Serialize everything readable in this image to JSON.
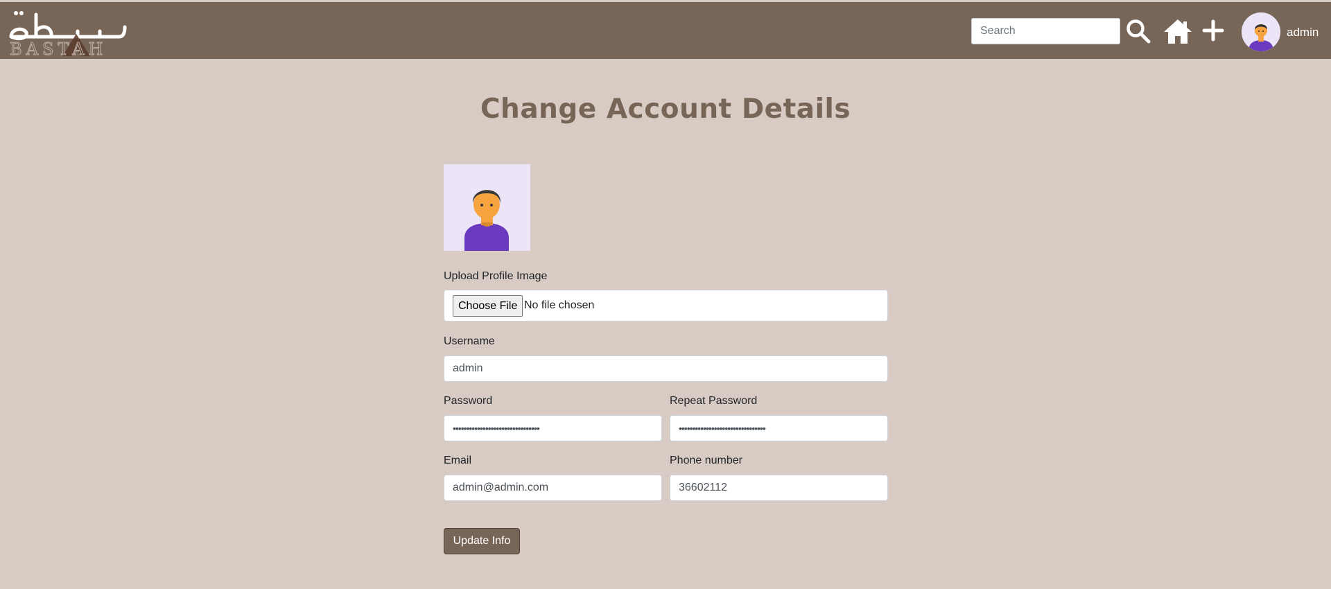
{
  "header": {
    "logo_text": "BASTAH",
    "search_placeholder": "Search",
    "username": "admin"
  },
  "page": {
    "title": "Change Account Details"
  },
  "form": {
    "upload_label": "Upload Profile Image",
    "choose_file_label": "Choose File",
    "file_status": "No file chosen",
    "username_label": "Username",
    "username_value": "admin",
    "password_label": "Password",
    "password_value": "••••••••••••••••••••••••••••••••",
    "repeat_password_label": "Repeat Password",
    "repeat_password_value": "••••••••••••••••••••••••••••••••",
    "email_label": "Email",
    "email_value": "admin@admin.com",
    "phone_label": "Phone number",
    "phone_value": "36602112",
    "submit_label": "Update Info"
  },
  "colors": {
    "brand": "#776558",
    "background": "#d7cbc3",
    "avatar_bg": "#ebe5f7"
  },
  "icons": [
    "search-icon",
    "home-icon",
    "plus-icon",
    "avatar"
  ]
}
